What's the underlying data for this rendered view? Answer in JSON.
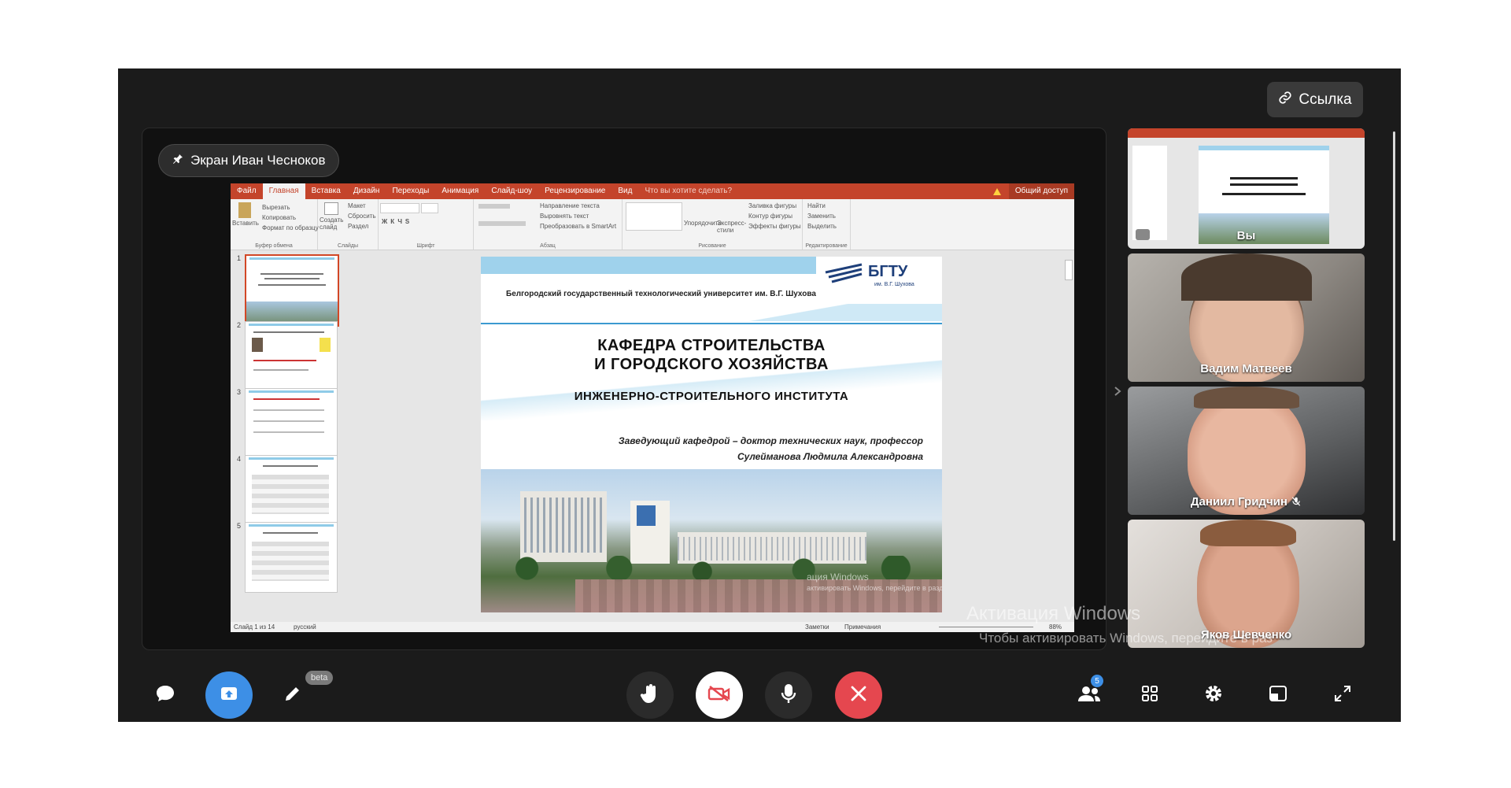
{
  "header": {
    "link_label": "Ссылка"
  },
  "stage": {
    "screen_owner_label": "Экран Иван Чесноков"
  },
  "powerpoint": {
    "tabs": [
      "Файл",
      "Главная",
      "Вставка",
      "Дизайн",
      "Переходы",
      "Анимация",
      "Слайд-шоу",
      "Рецензирование",
      "Вид"
    ],
    "tell_me": "Что вы хотите сделать?",
    "share": "Общий доступ",
    "ribbon": {
      "paste": "Вставить",
      "cut": "Вырезать",
      "copy": "Копировать",
      "format_painter": "Формат по образцу",
      "clipboard_group": "Буфер обмена",
      "new_slide": "Создать слайд",
      "layout": "Макет",
      "reset": "Сбросить",
      "section": "Раздел",
      "slides_group": "Слайды",
      "font_group": "Шрифт",
      "text_direction": "Направление текста",
      "align_text": "Выровнять текст",
      "smartart": "Преобразовать в SmartArt",
      "paragraph_group": "Абзац",
      "arrange": "Упорядочить",
      "quick_styles": "Экспресс-стили",
      "shape_fill": "Заливка фигуры",
      "shape_outline": "Контур фигуры",
      "shape_effects": "Эффекты фигуры",
      "drawing_group": "Рисование",
      "find": "Найти",
      "replace": "Заменить",
      "select": "Выделить",
      "editing_group": "Редактирование"
    },
    "thumbs": [
      "1",
      "2",
      "3",
      "4",
      "5"
    ],
    "status": {
      "slide_of": "Слайд 1 из 14",
      "language": "русский",
      "notes": "Заметки",
      "comments": "Примечания",
      "zoom": "88%"
    },
    "slide": {
      "logo": "БГТУ",
      "logo_sub": "им. В.Г. Шухова",
      "university": "Белгородский государственный технологический университет им. В.Г. Шухова",
      "title_line1": "КАФЕДРА СТРОИТЕЛЬСТВА",
      "title_line2": "И ГОРОДСКОГО ХОЗЯЙСТВА",
      "subtitle": "ИНЖЕНЕРНО-СТРОИТЕЛЬНОГО ИНСТИТУТА",
      "head_line1": "Заведующий  кафедрой – доктор технических наук,  профессор",
      "head_line2": "Сулейманова Людмила Александровна",
      "watermark_line1": "ация Windows",
      "watermark_line2": "активировать Windows, перейдите в раздел"
    }
  },
  "participants": [
    {
      "name": "Вы"
    },
    {
      "name": "Вадим Матвеев"
    },
    {
      "name": "Даниил Гридчин"
    },
    {
      "name": "Яков Шевченко"
    }
  ],
  "toolbar": {
    "draw_badge": "beta",
    "participants_count": "5"
  },
  "windows_watermark": {
    "line1": "Активация Windows",
    "line2": "Чтобы активировать Windows, перейдите в раз"
  },
  "colors": {
    "share_blue": "#3d8fe6",
    "end_call_red": "#e5474f",
    "ppt_accent": "#c4442b"
  }
}
